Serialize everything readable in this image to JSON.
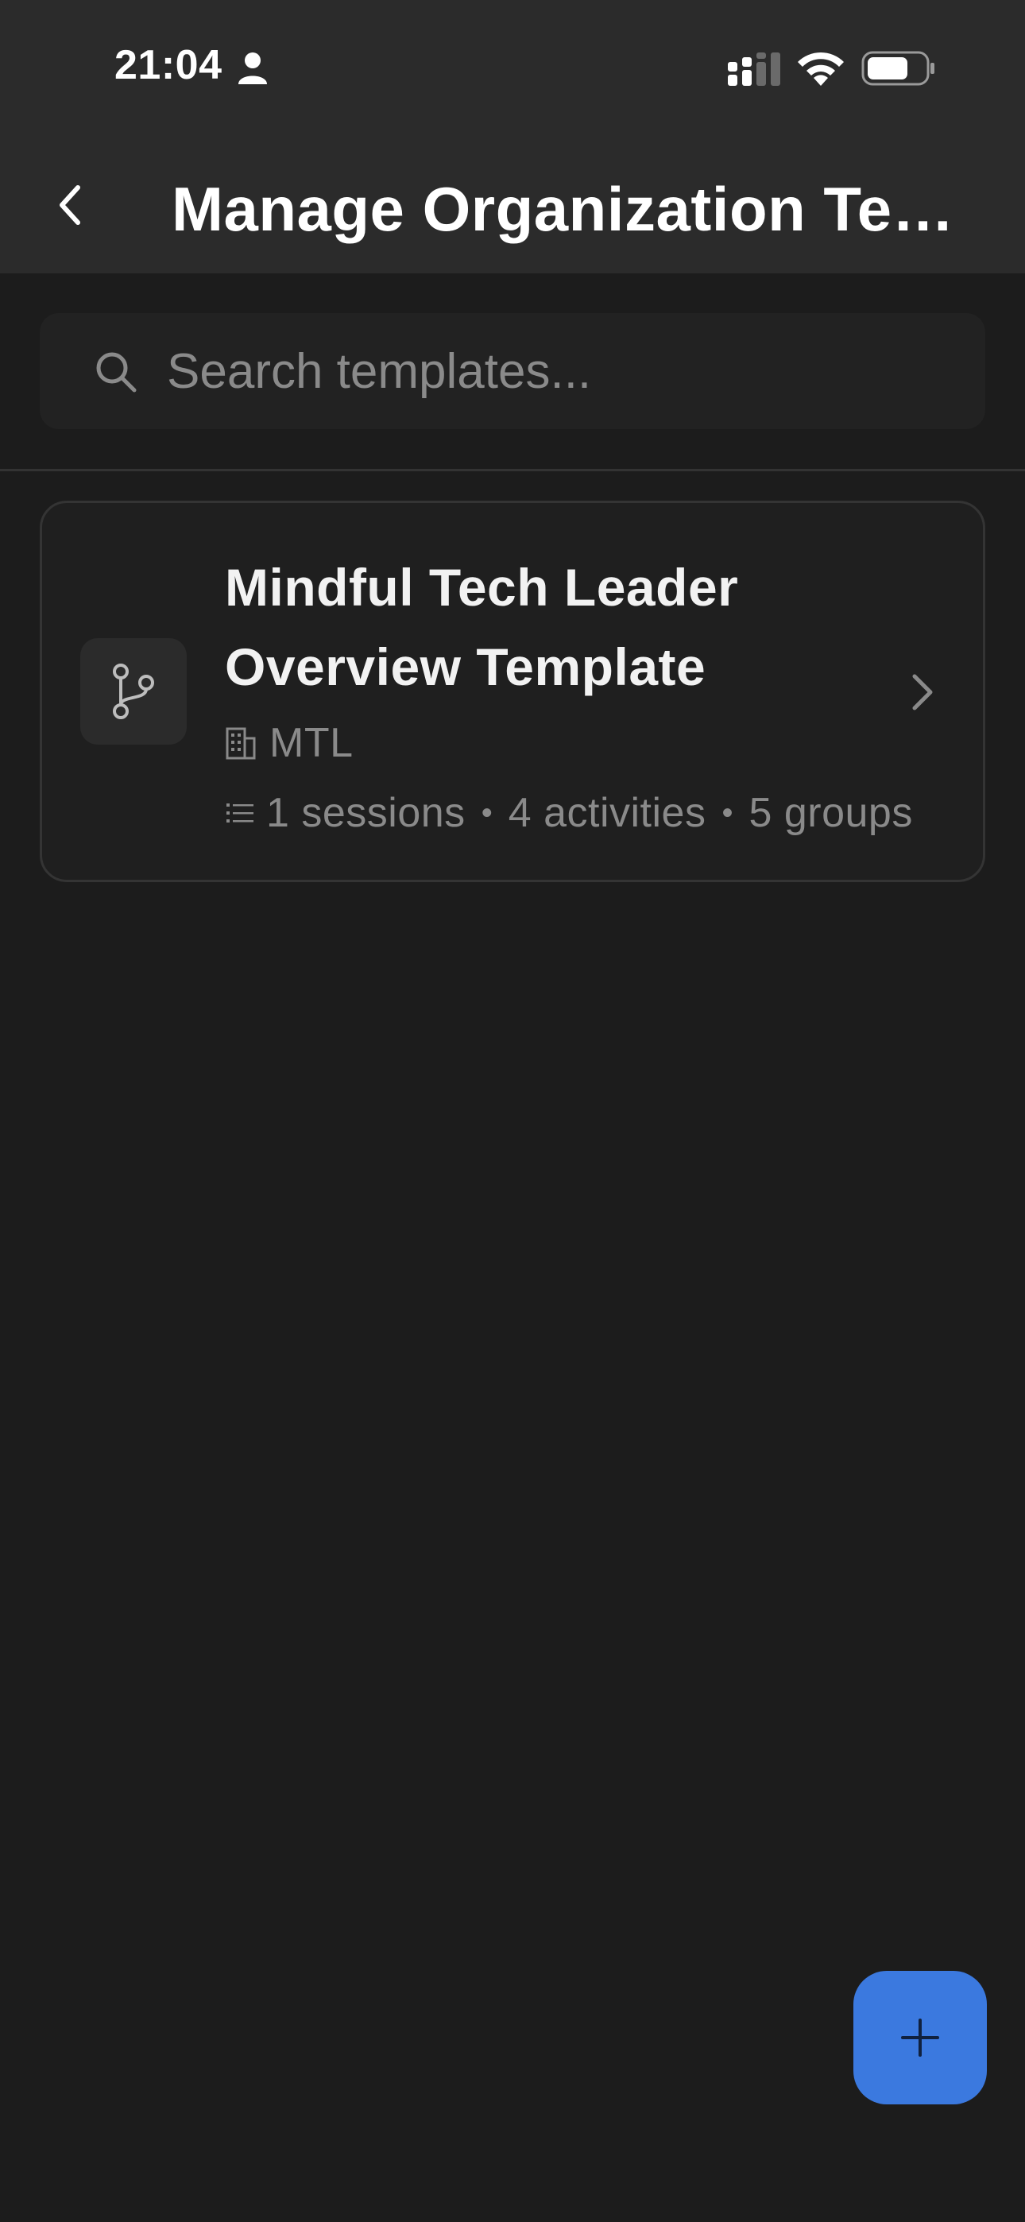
{
  "status_bar": {
    "time": "21:04",
    "icons": [
      "person-icon",
      "cellular-signal-icon",
      "wifi-icon",
      "battery-icon"
    ]
  },
  "nav": {
    "back_icon": "chevron-left-icon",
    "title": "Manage Organization Templates"
  },
  "search": {
    "placeholder": "Search templates...",
    "value": "",
    "icon": "search-icon"
  },
  "templates": [
    {
      "icon": "git-branch-icon",
      "title": "Mindful Tech Leader Overview Template",
      "organization_icon": "building-icon",
      "organization": "MTL",
      "stats_icon": "list-icon",
      "sessions": "1 sessions",
      "activities": "4 activities",
      "groups": "5 groups",
      "separator": "•"
    }
  ],
  "fab": {
    "icon": "plus-icon"
  },
  "colors": {
    "background": "#1c1c1c",
    "header": "#2b2b2b",
    "card_border": "#343434",
    "muted_text": "#8a8a8a",
    "accent": "#3b79df"
  }
}
